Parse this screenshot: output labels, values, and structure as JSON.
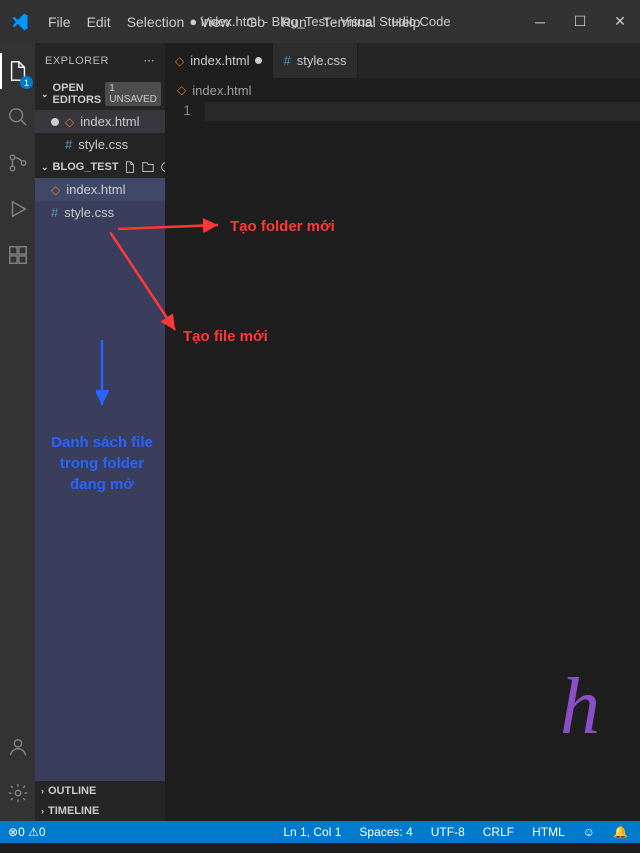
{
  "title": "● index.html - Blog_Test - Visual Studio Code",
  "menu": [
    "File",
    "Edit",
    "Selection",
    "View",
    "Go",
    "Run",
    "Terminal",
    "Help"
  ],
  "explorer": {
    "label": "EXPLORER"
  },
  "openEditors": {
    "label": "OPEN EDITORS",
    "badge": "1 UNSAVED"
  },
  "openFiles": [
    {
      "name": "index.html",
      "modified": true,
      "icon": "html"
    },
    {
      "name": "style.css",
      "modified": false,
      "icon": "css"
    }
  ],
  "project": {
    "label": "BLOG_TEST"
  },
  "projFiles": [
    {
      "name": "index.html",
      "icon": "html",
      "selected": true
    },
    {
      "name": "style.css",
      "icon": "css",
      "selected": false
    }
  ],
  "outline": {
    "label": "OUTLINE"
  },
  "timeline": {
    "label": "TIMELINE"
  },
  "tabs": [
    {
      "name": "index.html",
      "icon": "html",
      "active": true,
      "modified": true
    },
    {
      "name": "style.css",
      "icon": "css",
      "active": false,
      "modified": false
    }
  ],
  "breadcrumb": {
    "icon": "html",
    "name": "index.html"
  },
  "gutter": {
    "line": "1"
  },
  "status": {
    "errors": "0",
    "warnings": "0",
    "ln": "Ln 1, Col 1",
    "spaces": "Spaces: 4",
    "enc": "UTF-8",
    "eol": "CRLF",
    "lang": "HTML"
  },
  "annotations": {
    "folder": "Tạo folder mới",
    "file": "Tạo file mới",
    "list": "Danh sách file trong folder đang mở"
  },
  "badge": "1"
}
